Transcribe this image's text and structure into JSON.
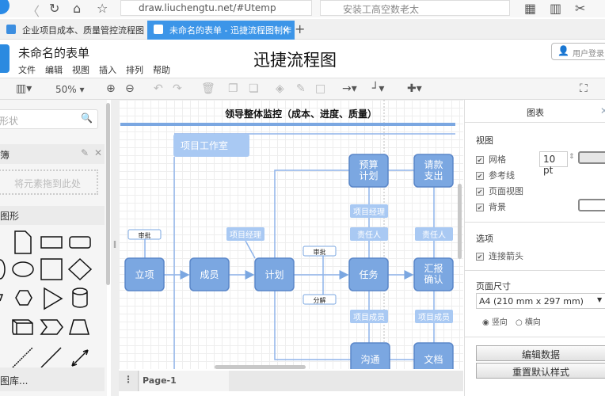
{
  "browser": {
    "url": "draw.liuchengtu.net/#Utemp",
    "search_placeholder": "安装工高空数老太",
    "tabs": [
      {
        "label": "企业项目成本、质量管控流程图"
      },
      {
        "label": "未命名的表单 - 迅捷流程图制作"
      }
    ]
  },
  "app": {
    "doc_title": "未命名的表单",
    "brand": "迅捷流程图",
    "login": "用户登录",
    "menu": [
      "文件",
      "编辑",
      "视图",
      "插入",
      "排列",
      "帮助"
    ],
    "zoom": "50%"
  },
  "sidebar": {
    "search_placeholder": "形状",
    "scratchpad_title": "簿",
    "scratchpad_drop": "将元素拖到此处",
    "shapes_title": "图形",
    "more_shapes": "图库..."
  },
  "diagram": {
    "title": "领导整体监控（成本、进度、质量）",
    "lane": "项目工作室",
    "nodes": {
      "lixiang": "立项",
      "chengyuan": "成员",
      "jihua": "计划",
      "renwu": "任务",
      "huibao1": "汇报",
      "huibao2": "确认",
      "yusuan1": "预算",
      "yusuan2": "计划",
      "qingkuan1": "请款",
      "qingkuan2": "支出",
      "goutong": "沟通",
      "wendang": "文档"
    },
    "labels": {
      "shenpi1": "审批",
      "pm1": "项目经理",
      "shenpi2": "审批",
      "fenjie": "分解",
      "pm2": "项目经理",
      "zr1": "责任人",
      "zr2": "责任人",
      "cy1": "项目成员",
      "cy2": "项目成员"
    },
    "colors": {
      "node": "#7ba7e1",
      "node_border": "#5b87c9",
      "label": "#a9c9f3",
      "line": "#8fb4ea"
    }
  },
  "pages": {
    "current": "Page-1"
  },
  "panel": {
    "title": "图表",
    "view": "视图",
    "grid": "网格",
    "grid_size": "10 pt",
    "guides": "参考线",
    "page_view": "页面视图",
    "background": "背景",
    "options": "选项",
    "connect_arrows": "连接箭头",
    "page_size": "页面尺寸",
    "paper": "A4 (210 mm x 297 mm)",
    "portrait": "竖向",
    "landscape": "横向",
    "edit_data": "编辑数据",
    "reset_style": "重置默认样式"
  }
}
